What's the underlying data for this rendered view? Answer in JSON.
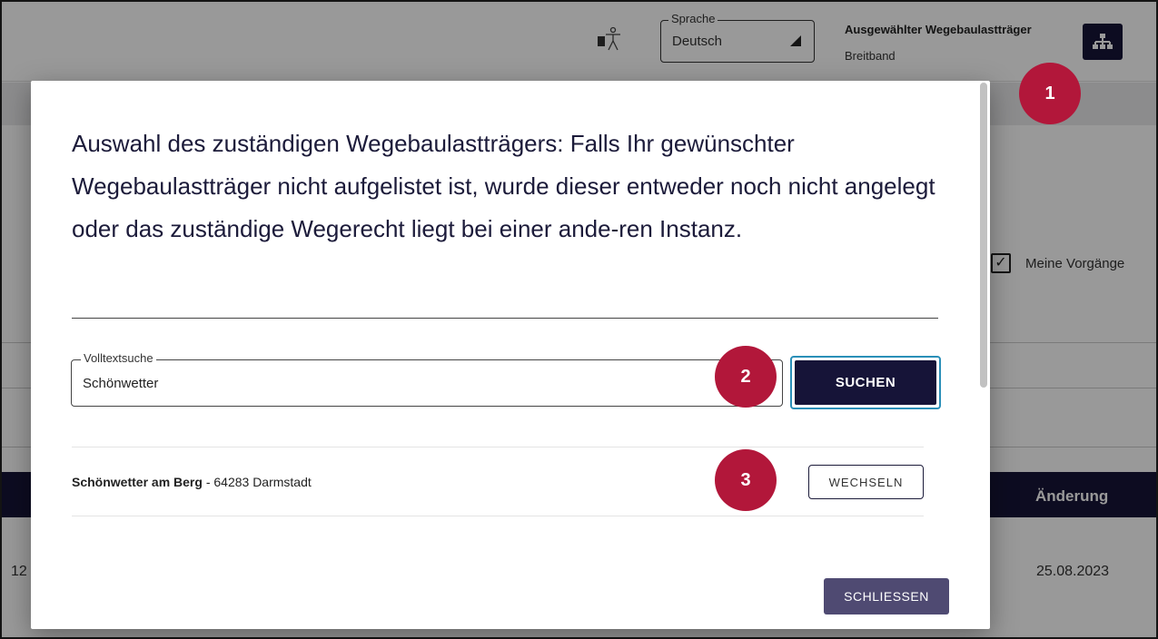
{
  "header": {
    "accessibility_icon": "accessibility-icon",
    "language_label": "Sprache",
    "language_value": "Deutsch",
    "wbt_label": "Ausgewählter Wegebaulastträger",
    "wbt_value": "Breitband",
    "org_icon": "sitemap-icon"
  },
  "background": {
    "meine_vorgaenge_label": "Meine Vorgänge",
    "table_header_aenderung": "Änderung",
    "row_date": "25.08.2023",
    "row_id_partial": "12"
  },
  "dialog": {
    "title": "Auswahl des zuständigen Wegebaulastträgers: Falls Ihr gewünschter Wegebaulastträger nicht aufgelistet ist, wurde dieser entweder noch nicht angelegt oder das zuständige Wegerecht liegt bei einer ande-ren Instanz.",
    "search_label": "Volltextsuche",
    "search_value": "Schönwetter",
    "search_button": "SUCHEN",
    "results": [
      {
        "name": "Schönwetter am Berg",
        "detail": " - 64283 Darmstadt",
        "action": "WECHSELN"
      }
    ],
    "close_button": "SCHLIESSEN"
  },
  "markers": [
    "1",
    "2",
    "3"
  ],
  "colors": {
    "primary": "#161438",
    "accent_focus": "#2a8fb8",
    "marker": "#b2173a",
    "close_button": "#4f4a72"
  }
}
